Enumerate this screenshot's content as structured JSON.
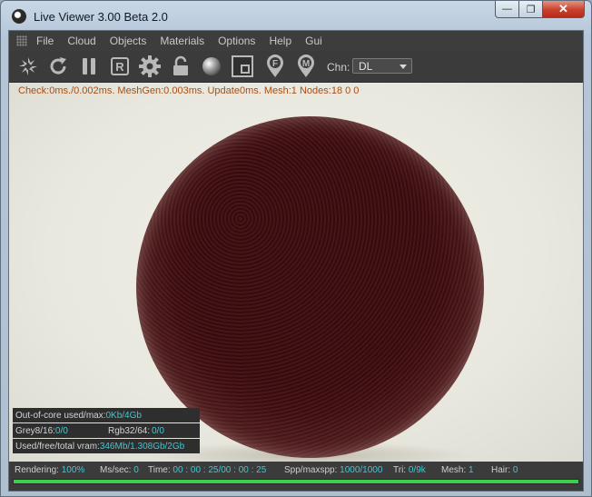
{
  "window": {
    "title": "Live Viewer 3.00 Beta 2.0",
    "controls": {
      "minimize": "—",
      "maximize": "❐",
      "close": "✕"
    }
  },
  "menu": {
    "items": [
      "File",
      "Cloud",
      "Objects",
      "Materials",
      "Options",
      "Help",
      "Gui"
    ]
  },
  "toolbar": {
    "icons": [
      "send-scene-icon",
      "restart-icon",
      "pause-icon",
      "region-render-icon",
      "settings-gear-icon",
      "lock-icon",
      "material-sphere-icon",
      "render-region-icon",
      "focus-pin-icon",
      "material-pick-pin-icon"
    ],
    "pin_letters": {
      "focus": "F",
      "material": "M"
    },
    "region_letter": "R",
    "channel_label": "Chn:",
    "channel_value": "DL"
  },
  "viewport": {
    "stats": "Check:0ms./0.002ms. MeshGen:0.003ms. Update0ms. Mesh:1 Nodes:18  0 0",
    "info": {
      "out_of_core_label": "Out-of-core used/max:",
      "out_of_core_value": "0Kb/4Gb",
      "grey_label": "Grey8/16: ",
      "grey_value": "0/0",
      "rgb_label": "Rgb32/64: ",
      "rgb_value": "0/0",
      "vram_label": "Used/free/total vram: ",
      "vram_value": "346Mb/1.308Gb/2Gb"
    }
  },
  "status": {
    "rendering_label": "Rendering: ",
    "rendering_value": "100%",
    "ms_label": "Ms/sec: ",
    "ms_value": "0",
    "time_label": "Time: ",
    "time_value": "00 : 00 : 25/00 : 00 : 25",
    "spp_label": "Spp/maxspp: ",
    "spp_value": "1000/1000",
    "tri_label": "Tri: ",
    "tri_value": "0/9k",
    "mesh_label": "Mesh: ",
    "mesh_value": "1",
    "hair_label": "Hair: ",
    "hair_value": "0",
    "progress": 1.0
  },
  "colors": {
    "progress": "#3ccf4e",
    "stats_text": "#a74e12",
    "info_value": "#3fc8d4",
    "sphere": "#3b0a0d"
  }
}
